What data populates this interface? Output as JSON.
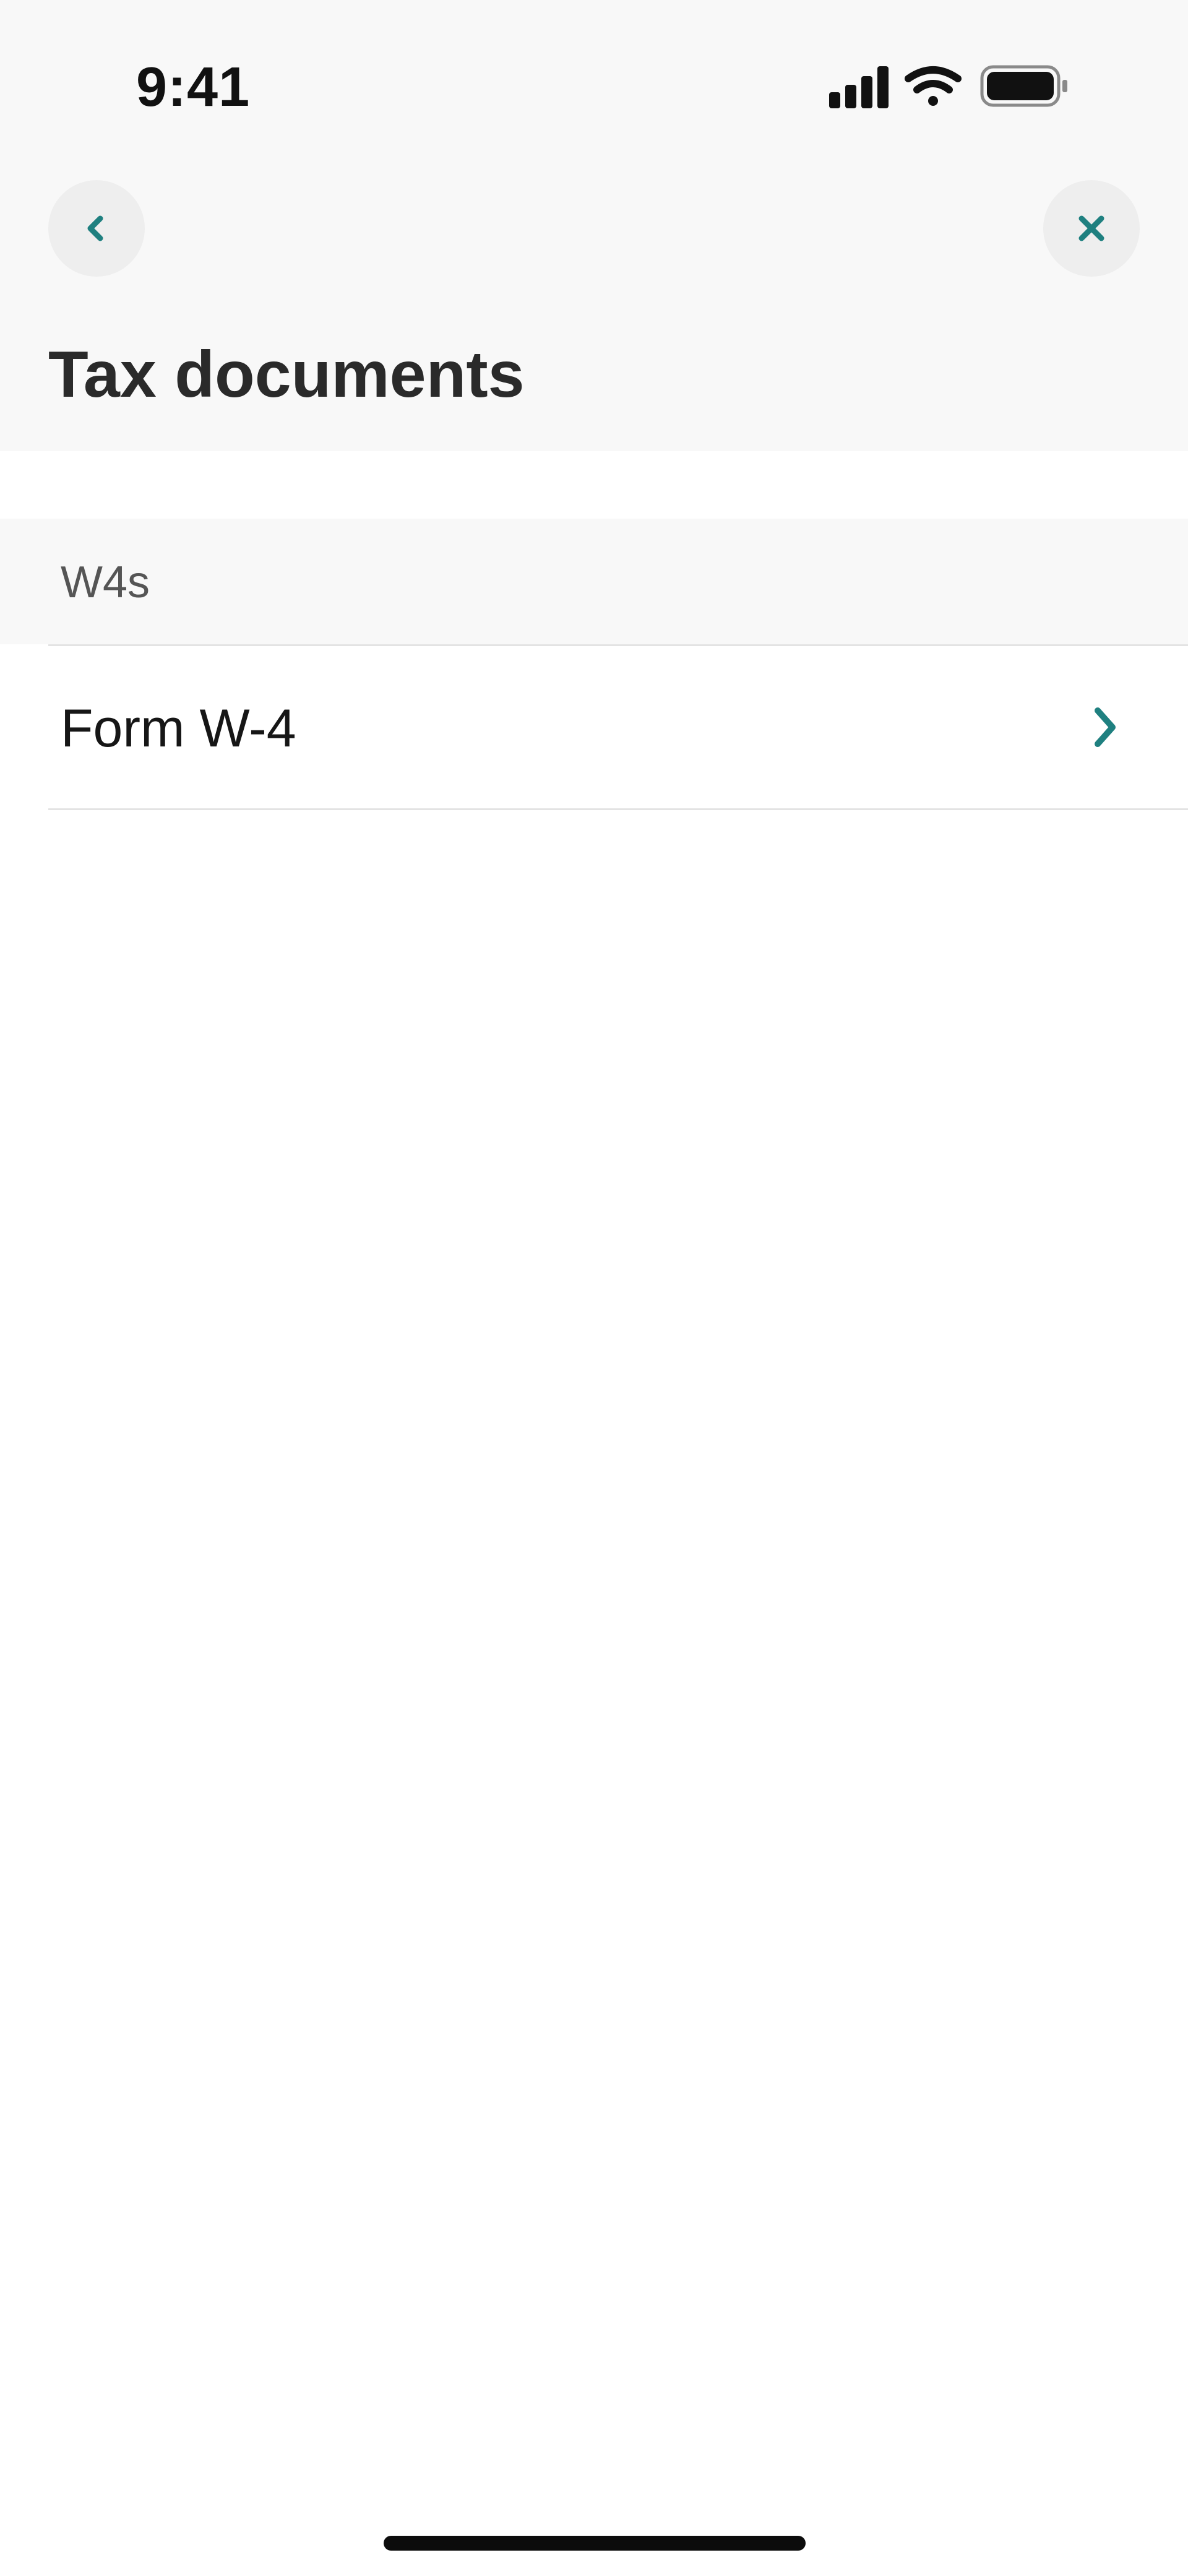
{
  "status_bar": {
    "time": "9:41",
    "icons": [
      "cellular-signal-icon",
      "wifi-icon",
      "battery-icon"
    ]
  },
  "navigation": {
    "back_icon": "chevron-left-icon",
    "close_icon": "close-icon"
  },
  "page": {
    "title": "Tax documents"
  },
  "sections": [
    {
      "header": "W4s",
      "items": [
        {
          "label": "Form W-4",
          "icon": "chevron-right-icon"
        }
      ]
    }
  ],
  "colors": {
    "accent": "#1f8080",
    "header_background": "#f8f8f8",
    "nav_button_background": "#eeeeee",
    "title_text": "#2a2a2a",
    "section_label_text": "#555555",
    "divider": "#e3e3e3"
  }
}
